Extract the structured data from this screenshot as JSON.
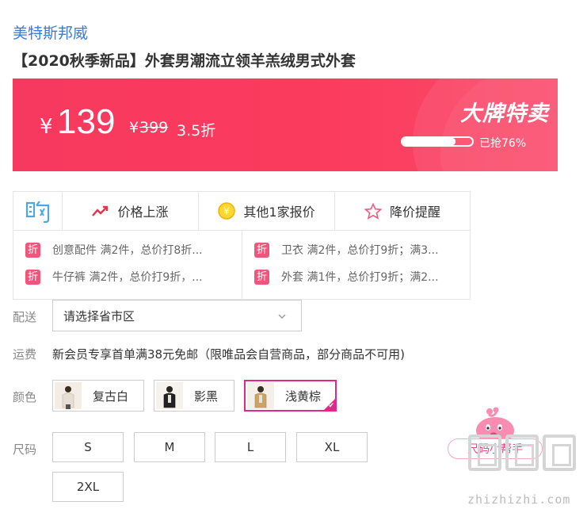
{
  "brand": "美特斯邦威",
  "title": "【2020秋季新品】外套男潮流立领羊羔绒男式外套",
  "banner": {
    "currency": "¥",
    "price": "139",
    "old_currency": "¥",
    "old_price": "399",
    "discount": "3.5折",
    "badge": "大牌特卖",
    "progress_text": "已抢76%",
    "progress_value": 0.76,
    "accent": "#f7395f"
  },
  "promo": {
    "tabs": [
      {
        "icon": "trend-up-icon",
        "label": "价格上涨"
      },
      {
        "icon": "yen-coin-icon",
        "label": "其他1家报价"
      },
      {
        "icon": "star-outline-icon",
        "label": "降价提醒"
      }
    ],
    "badge_char": "折",
    "deals": [
      "创意配件 满2件，总价打8折...",
      "卫衣 满2件，总价打9折；满3...",
      "牛仔裤 满2件，总价打9折，...",
      "外套 满1件，总价打9折；满2..."
    ]
  },
  "delivery": {
    "label": "配送",
    "placeholder": "请选择省市区"
  },
  "shipping": {
    "label": "运费",
    "text": "新会员专享首单满38元免邮（限唯品会自营商品，部分商品不可用)"
  },
  "color": {
    "label": "颜色",
    "options": [
      "复古白",
      "影黑",
      "浅黄棕"
    ],
    "selected": "浅黄棕",
    "selected_color": "#e2278b"
  },
  "size": {
    "label": "尺码",
    "options": [
      "S",
      "M",
      "L",
      "XL",
      "2XL"
    ]
  },
  "helper": {
    "label": "尺码小帮手"
  },
  "watermark": {
    "text": "zhizhizhi.com"
  }
}
